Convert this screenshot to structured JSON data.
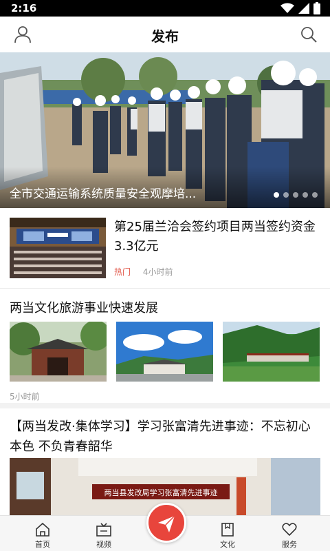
{
  "status_bar": {
    "time": "2:16"
  },
  "header": {
    "title": "发布"
  },
  "banner": {
    "caption": "全市交通运输系统质量安全观摩培...",
    "slide_count": 5,
    "active_slide": 1
  },
  "news": [
    {
      "title": "第25届兰洽会签约项目两当签约资金3.3亿元",
      "tag": "热门",
      "time": "4小时前"
    },
    {
      "title": "两当文化旅游事业快速发展",
      "time": "5小时前"
    },
    {
      "title": "【两当发改·集体学习】学习张富清先进事迹：不忘初心本色 不负青春韶华",
      "image_banner_text": "两当县发改局学习张富清先进事迹"
    }
  ],
  "bottom_nav": {
    "home": "首页",
    "video": "视频",
    "culture": "文化",
    "service": "服务"
  },
  "colors": {
    "accent": "#e8453c",
    "hot_tag": "#e25a4c",
    "meta_text": "#999999"
  }
}
